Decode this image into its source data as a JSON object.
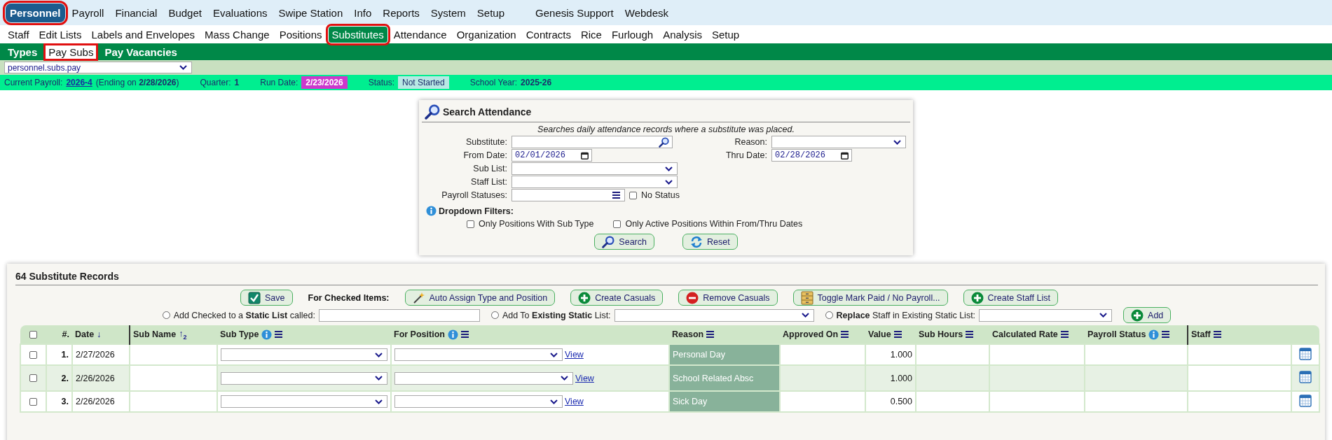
{
  "menu": [
    {
      "label": "Personnel",
      "selected": true
    },
    {
      "label": "Payroll",
      "selected": false
    },
    {
      "label": "Financial",
      "selected": false
    },
    {
      "label": "Budget",
      "selected": false
    },
    {
      "label": "Evaluations",
      "selected": false
    },
    {
      "label": "Swipe Station",
      "selected": false
    },
    {
      "label": "Info",
      "selected": false
    },
    {
      "label": "Reports",
      "selected": false
    },
    {
      "label": "System",
      "selected": false
    },
    {
      "label": "Setup",
      "selected": false
    }
  ],
  "support_menu": [
    {
      "label": "Genesis Support",
      "selected": false
    },
    {
      "label": "Webdesk",
      "selected": false
    }
  ],
  "submenu": [
    {
      "label": "Staff",
      "selected": false
    },
    {
      "label": "Edit Lists",
      "selected": false
    },
    {
      "label": "Labels and Envelopes",
      "selected": false
    },
    {
      "label": "Mass Change",
      "selected": false
    },
    {
      "label": "Positions",
      "selected": false
    },
    {
      "label": "Substitutes",
      "selected": true
    },
    {
      "label": "Attendance",
      "selected": false
    },
    {
      "label": "Organization",
      "selected": false
    },
    {
      "label": "Contracts",
      "selected": false
    },
    {
      "label": "Rice",
      "selected": false
    },
    {
      "label": "Furlough",
      "selected": false
    },
    {
      "label": "Analysis",
      "selected": false
    },
    {
      "label": "Setup",
      "selected": false
    }
  ],
  "tabs": [
    {
      "label": "Types",
      "selected": false
    },
    {
      "label": "Pay Subs",
      "selected": true
    },
    {
      "label": "Pay Vacancies",
      "selected": false
    }
  ],
  "program_select": {
    "value": "personnel.subs.pay"
  },
  "status_bar": {
    "payroll_label": "Current Payroll:",
    "payroll_link": "2026-4",
    "payroll_ending": "(Ending on **2/28/2026**)",
    "quarter_label": "Quarter:",
    "quarter": "1",
    "run_date_label": "Run Date:",
    "run_date": "2/23/2026",
    "status_label": "Status:",
    "status": "Not Started",
    "school_year_label": "School Year:",
    "school_year": "2025-26"
  },
  "search": {
    "title": "Search Attendance",
    "description": "Searches daily attendance records where a substitute was placed.",
    "substitute_label": "Substitute:",
    "reason_label": "Reason:",
    "from_label": "From Date:",
    "from_value": "02/01/2026",
    "thru_label": "Thru Date:",
    "thru_value": "02/28/2026",
    "sub_list_label": "Sub List:",
    "staff_list_label": "Staff List:",
    "payroll_statuses_label": "Payroll Statuses:",
    "no_status": {
      "label": "No Status",
      "checked": false
    },
    "filters_label": "Dropdown Filters:",
    "filters": [
      {
        "label": "Only Positions With Sub Type",
        "checked": false
      },
      {
        "label": "Only Active Positions Within From/Thru Dates",
        "checked": false
      }
    ],
    "buttons": [
      {
        "label": "Search",
        "kind": "search"
      },
      {
        "label": "Reset",
        "kind": "reset"
      }
    ]
  },
  "records": {
    "title": "64 Substitute Records",
    "for_checked_label": "For Checked Items:",
    "buttons": [
      {
        "label": "Save",
        "kind": "save"
      },
      {
        "label": "Auto Assign Type and Position",
        "kind": "wand"
      },
      {
        "label": "Create Casuals",
        "kind": "add"
      },
      {
        "label": "Remove Casuals",
        "kind": "remove"
      },
      {
        "label": "Toggle Mark Paid / No Payroll...",
        "kind": "cabinet"
      },
      {
        "label": "Create Staff List",
        "kind": "add"
      }
    ],
    "list_options": [
      {
        "label": "Add Checked to a **Static List** called:",
        "selected": false,
        "kind": "text"
      },
      {
        "label": "Add To **Existing Static** List:",
        "selected": false,
        "kind": "select"
      },
      {
        "label": "**Replace** Staff in Existing Static List:",
        "selected": false,
        "kind": "select"
      }
    ],
    "add_button": {
      "label": "Add",
      "kind": "add"
    },
    "select_all": {
      "checked": false
    },
    "columns": [
      {
        "label": "#."
      },
      {
        "label": "Date",
        "sort": "↓"
      },
      {
        "label": "Sub Name",
        "sort": "↑",
        "sort_rank": "2"
      },
      {
        "label": "Sub Type",
        "info": true,
        "menu": true
      },
      {
        "label": "For Position",
        "info": true,
        "menu": true
      },
      {
        "label": "Reason",
        "menu": true
      },
      {
        "label": "Approved On",
        "menu": true
      },
      {
        "label": "Value",
        "menu": true
      },
      {
        "label": "Sub Hours",
        "menu": true
      },
      {
        "label": "Calculated Rate",
        "menu": true
      },
      {
        "label": "Payroll Status",
        "info": true,
        "menu": true
      },
      {
        "label": "Staff",
        "menu": true
      }
    ],
    "rows": [
      {
        "checked": false,
        "number": "1.",
        "date": "2/27/2026",
        "link": "View",
        "reason": "Personal Day",
        "value": "1.000"
      },
      {
        "checked": false,
        "number": "2.",
        "date": "2/26/2026",
        "link": "View",
        "reason": "School Related Absc",
        "value": "1.000"
      },
      {
        "checked": false,
        "number": "3.",
        "date": "2/26/2026",
        "link": "View",
        "reason": "Sick Day",
        "value": "0.500"
      }
    ]
  }
}
